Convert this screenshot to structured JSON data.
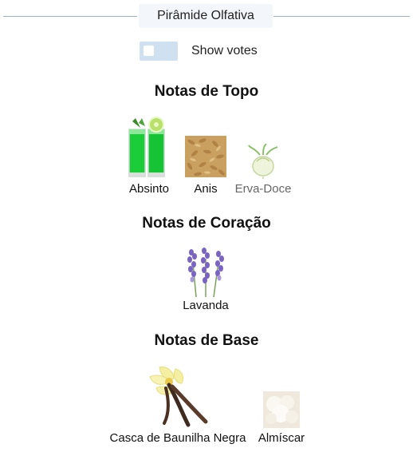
{
  "header": {
    "title": "Pirâmide Olfativa"
  },
  "toggle": {
    "label": "Show votes",
    "on": false
  },
  "sections": {
    "top": {
      "title": "Notas de Topo",
      "notes": [
        {
          "label": "Absinto",
          "icon": "absinthe-glasses-icon"
        },
        {
          "label": "Anis",
          "icon": "anise-seeds-icon"
        },
        {
          "label": "Erva-Doce",
          "icon": "fennel-bulb-icon"
        }
      ]
    },
    "heart": {
      "title": "Notas de Coração",
      "notes": [
        {
          "label": "Lavanda",
          "icon": "lavender-icon"
        }
      ]
    },
    "base": {
      "title": "Notas de Base",
      "notes": [
        {
          "label": "Casca de Baunilha Negra",
          "icon": "vanilla-flower-icon"
        },
        {
          "label": "Almíscar",
          "icon": "musk-cotton-icon"
        }
      ]
    }
  },
  "colors": {
    "accent_line": "#9fb3c6",
    "title_bg": "#f3f7fb",
    "toggle_bg": "#cfe0f1"
  }
}
